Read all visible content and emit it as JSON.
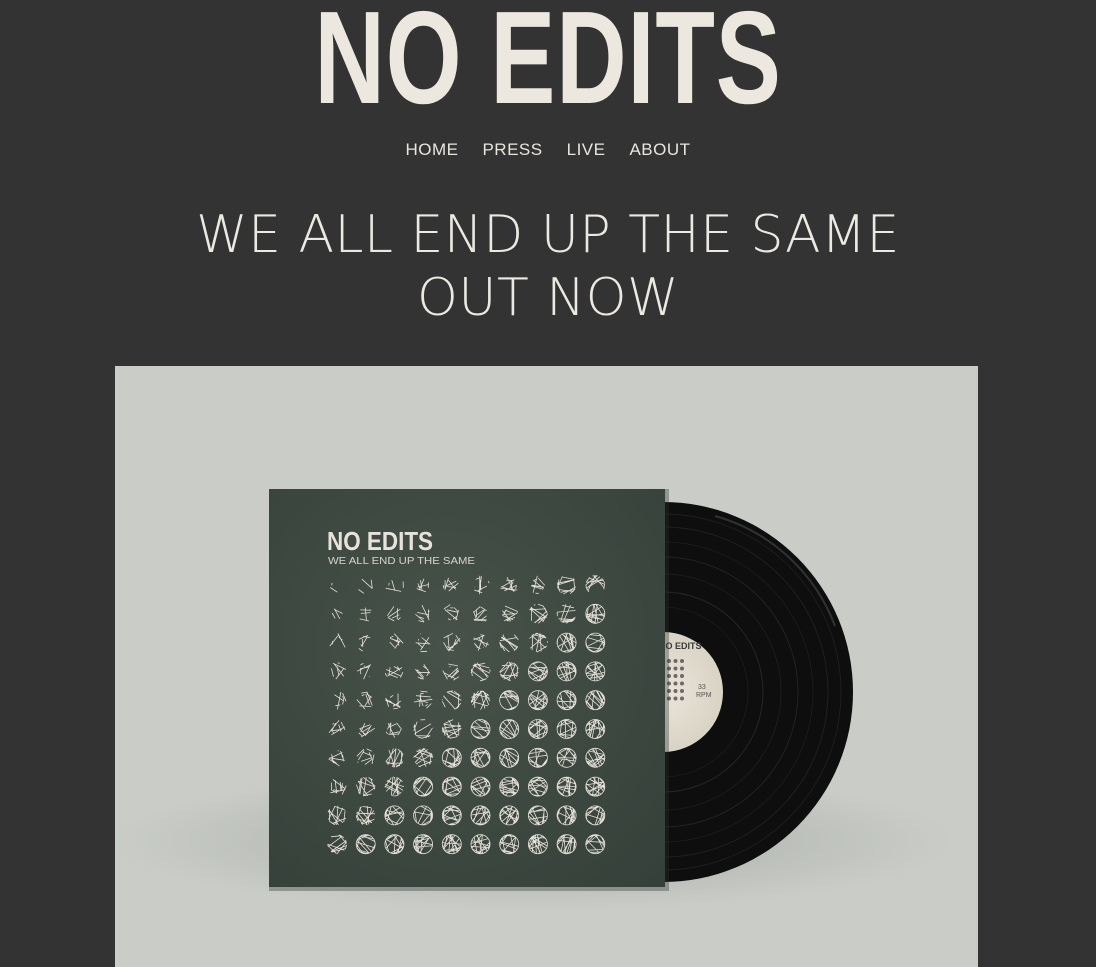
{
  "site": {
    "logo_text": "NO EDITS"
  },
  "nav": {
    "items": [
      "HOME",
      "PRESS",
      "LIVE",
      "ABOUT"
    ]
  },
  "hero": {
    "headline_line1": "WE ALL END UP THE SAME",
    "headline_line2": "OUT NOW"
  },
  "album": {
    "cover_title": "NO EDITS",
    "cover_subtitle": "WE ALL END UP THE SAME",
    "label_title": "NO EDITS",
    "label_rpm": "33",
    "label_rpm_unit": "RPM"
  },
  "colors": {
    "page_bg": "#333333",
    "text": "#ece9e2",
    "hero_bg": "#c9ccc7",
    "cover_green": "#3f4a42",
    "vinyl": "#111111",
    "label": "#e3ded2"
  }
}
